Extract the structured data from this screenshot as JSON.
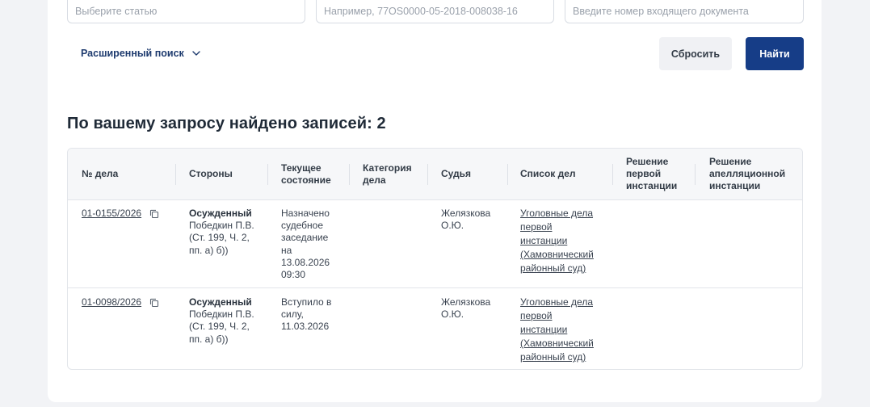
{
  "search": {
    "article_placeholder": "Выберите статью",
    "case_placeholder": "Например, 77OS0000-05-2018-008038-16",
    "doc_placeholder": "Введите номер входящего документа",
    "advanced_label": "Расширенный поиск",
    "reset_label": "Сбросить",
    "find_label": "Найти"
  },
  "results": {
    "title": "По вашему запросу найдено записей: 2",
    "columns": [
      "№ дела",
      "Стороны",
      "Текущее состояние",
      "Категория дела",
      "Судья",
      "Список дел",
      "Решение первой инстанции",
      "Решение апелляционной инстанции"
    ],
    "rows": [
      {
        "case_number": "01-0155/2026",
        "party_role": "Осужденный",
        "party_details": "Победкин П.В. (Ст. 199, Ч. 2, пп. а) б))",
        "status": "Назначено судебное заседание на 13.08.2026 09:30",
        "category": "",
        "judge": "Желязкова О.Ю.",
        "case_list": "Уголовные дела первой инстанции (Хамовнический районный суд)"
      },
      {
        "case_number": "01-0098/2026",
        "party_role": "Осужденный",
        "party_details": "Победкин П.В. (Ст. 199, Ч. 2, пп. а) б))",
        "status": "Вступило в силу, 11.03.2026",
        "category": "",
        "judge": "Желязкова О.Ю.",
        "case_list": "Уголовные дела первой инстанции (Хамовнический районный суд)"
      }
    ]
  },
  "colors": {
    "primary": "#163d87",
    "link": "#1d3a6e",
    "background": "#f2f3f6"
  },
  "icons": {
    "advanced_toggle": "chevron-down-icon",
    "copy": "copy-icon"
  }
}
